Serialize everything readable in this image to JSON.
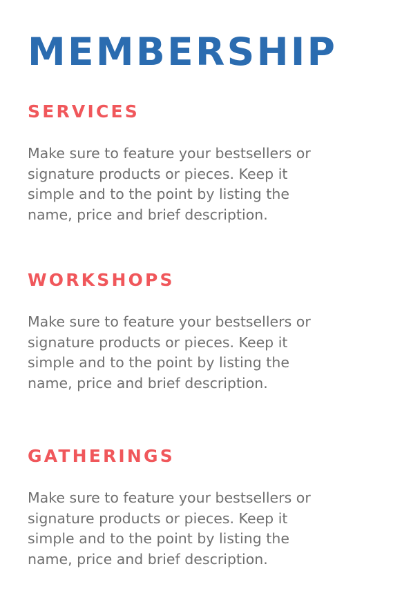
{
  "title": "MEMBERSHIP",
  "sections": [
    {
      "heading": "SERVICES",
      "lines": [
        "Make sure to feature your bestsellers or",
        "signature products or pieces. Keep it",
        "simple and to the point by listing the",
        "name, price and brief description."
      ]
    },
    {
      "heading": "WORKSHOPS",
      "lines": [
        "Make sure to feature your bestsellers or",
        "signature products or pieces. Keep it",
        "simple and to the point by listing the",
        "name, price and brief description."
      ]
    },
    {
      "heading": "GATHERINGS",
      "lines": [
        "Make sure to feature your bestsellers or",
        "signature products or pieces. Keep it",
        "simple and to the point by listing the",
        "name, price and brief description."
      ]
    }
  ],
  "colors": {
    "title": "#2b6cb0",
    "heading": "#f0575b",
    "body": "#6f6f6f",
    "background": "#ffffff"
  }
}
